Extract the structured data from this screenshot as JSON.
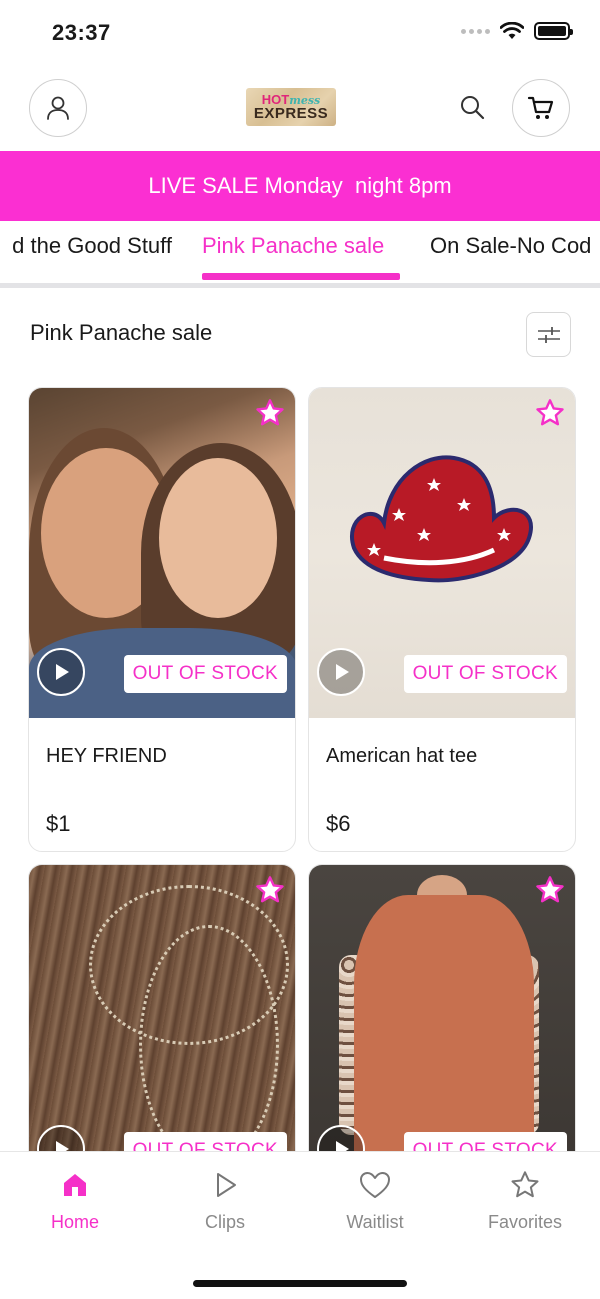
{
  "status_bar": {
    "time": "23:37"
  },
  "header": {
    "logo_top_hot": "HOT",
    "logo_top_mess": "mess",
    "logo_bottom": "EXPRESS"
  },
  "banner": {
    "text": "LIVE SALE Monday  night 8pm"
  },
  "category_tabs": [
    {
      "label": "d the Good Stuff"
    },
    {
      "label": "Pink Panache sale",
      "active": true
    },
    {
      "label": "On Sale-No Cod"
    }
  ],
  "section": {
    "title": "Pink Panache sale"
  },
  "products": [
    {
      "name": "HEY FRIEND",
      "price": "$1",
      "badge": "OUT OF STOCK",
      "image": "selfie-photo"
    },
    {
      "name": "American hat tee",
      "price": "$6",
      "badge": "OUT OF STOCK",
      "image": "cowboy-hat-tee"
    },
    {
      "name": "",
      "price": "",
      "badge": "OUT OF STOCK",
      "image": "cross-necklace"
    },
    {
      "name": "",
      "price": "",
      "badge": "OUT OF STOCK",
      "image": "rust-top"
    }
  ],
  "tabbar": [
    {
      "label": "Home",
      "icon": "home-icon",
      "active": true
    },
    {
      "label": "Clips",
      "icon": "play-icon"
    },
    {
      "label": "Waitlist",
      "icon": "heart-icon"
    },
    {
      "label": "Favorites",
      "icon": "star-icon"
    }
  ],
  "colors": {
    "accent": "#f530c8",
    "banner": "#fb2fd2"
  }
}
